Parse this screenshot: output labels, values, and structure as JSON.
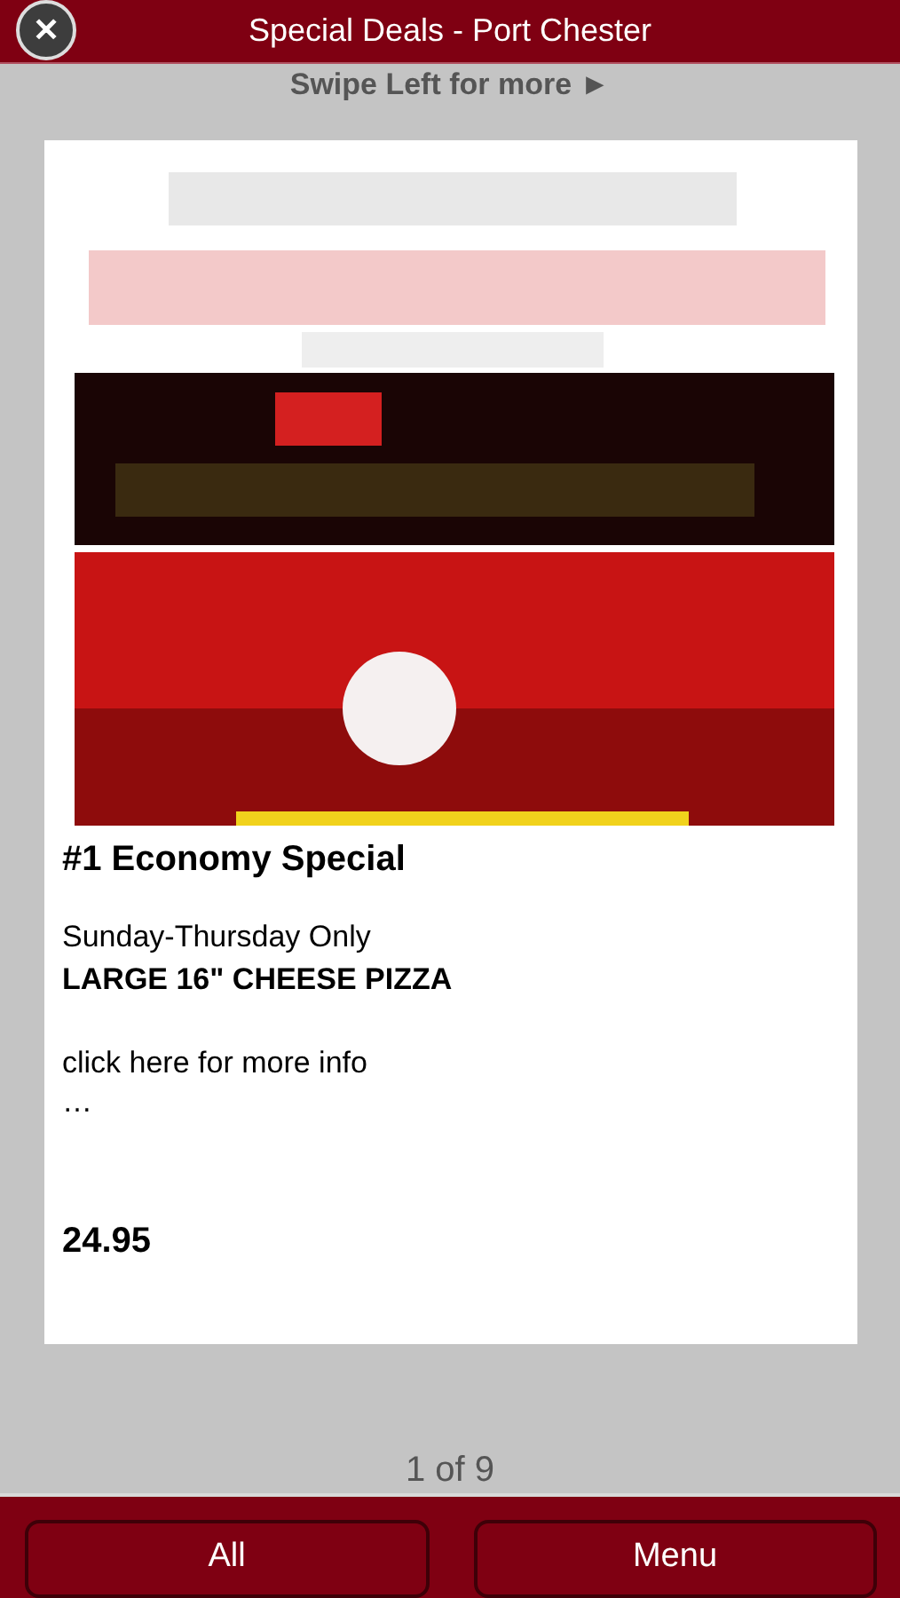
{
  "header": {
    "close": "✕",
    "title": "Special Deals - Port Chester"
  },
  "hint": "Swipe Left for more ►",
  "deal": {
    "title": "#1 Economy Special",
    "lines": [
      {
        "text": "Sunday-Thursday Only",
        "bold": false
      },
      {
        "text": "LARGE 16\" CHEESE PIZZA",
        "bold": true
      }
    ],
    "link": "click here for more info",
    "ellipsis": "…",
    "price": "24.95"
  },
  "pager": "1 of 9",
  "buttons": [
    "All",
    "Menu"
  ]
}
